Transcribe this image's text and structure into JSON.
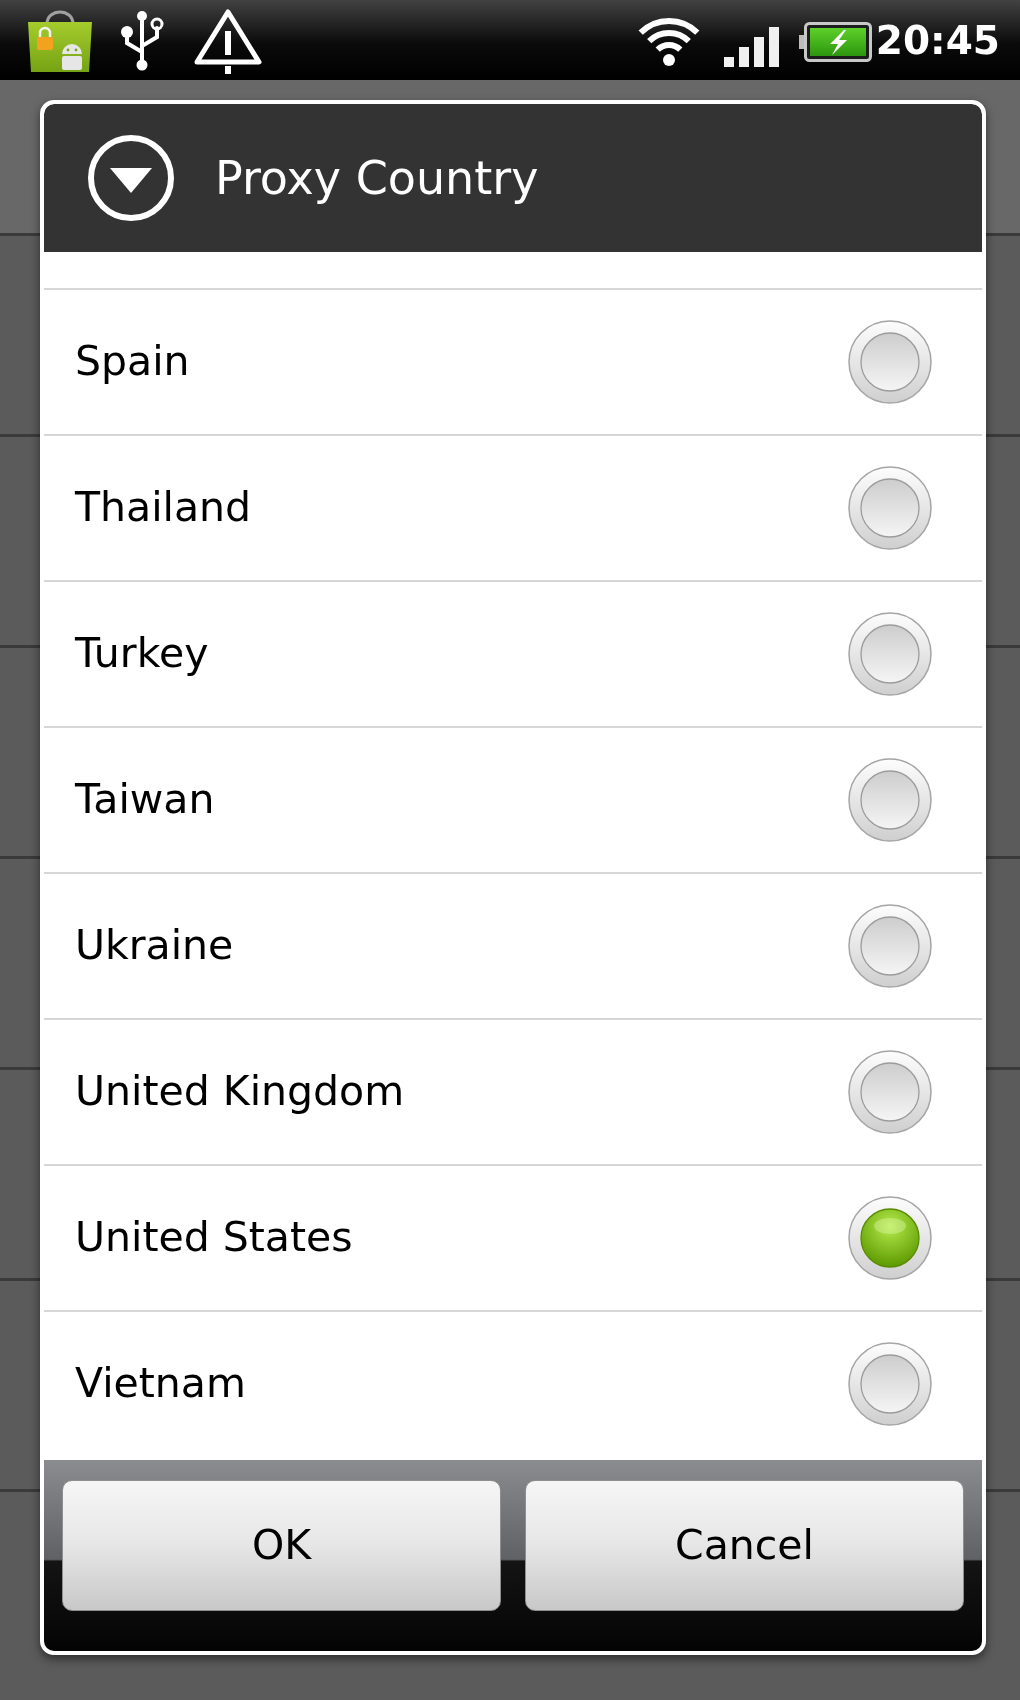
{
  "status_bar": {
    "time": "20:45"
  },
  "dialog": {
    "title": "Proxy Country",
    "options": [
      {
        "label": "Spain",
        "selected": false
      },
      {
        "label": "Thailand",
        "selected": false
      },
      {
        "label": "Turkey",
        "selected": false
      },
      {
        "label": "Taiwan",
        "selected": false
      },
      {
        "label": "Ukraine",
        "selected": false
      },
      {
        "label": "United Kingdom",
        "selected": false
      },
      {
        "label": "United States",
        "selected": true
      },
      {
        "label": "Vietnam",
        "selected": false
      }
    ],
    "buttons": [
      "OK",
      "Cancel"
    ]
  }
}
